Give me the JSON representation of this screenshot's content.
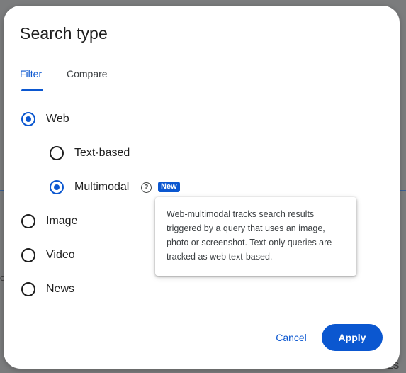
{
  "dialog": {
    "title": "Search type",
    "tabs": [
      {
        "label": "Filter",
        "active": true
      },
      {
        "label": "Compare",
        "active": false
      }
    ],
    "options": {
      "web": {
        "label": "Web",
        "checked": true
      },
      "text_based": {
        "label": "Text-based",
        "checked": false
      },
      "multimodal": {
        "label": "Multimodal",
        "checked": true,
        "help_icon": "help-circle-icon",
        "badge": "New"
      },
      "image": {
        "label": "Image",
        "checked": false
      },
      "video": {
        "label": "Video",
        "checked": false
      },
      "news": {
        "label": "News",
        "checked": false
      }
    },
    "tooltip": "Web-multimodal tracks search results triggered by a query that uses an image, photo or screenshot. Text-only queries are tracked as web text-based.",
    "buttons": {
      "cancel": "Cancel",
      "apply": "Apply"
    }
  },
  "background": {
    "fragment_text_left": "o",
    "fragment_text_bottom": "ES"
  },
  "colors": {
    "accent": "#0b57d0",
    "overlay": "#7b7c7d"
  }
}
